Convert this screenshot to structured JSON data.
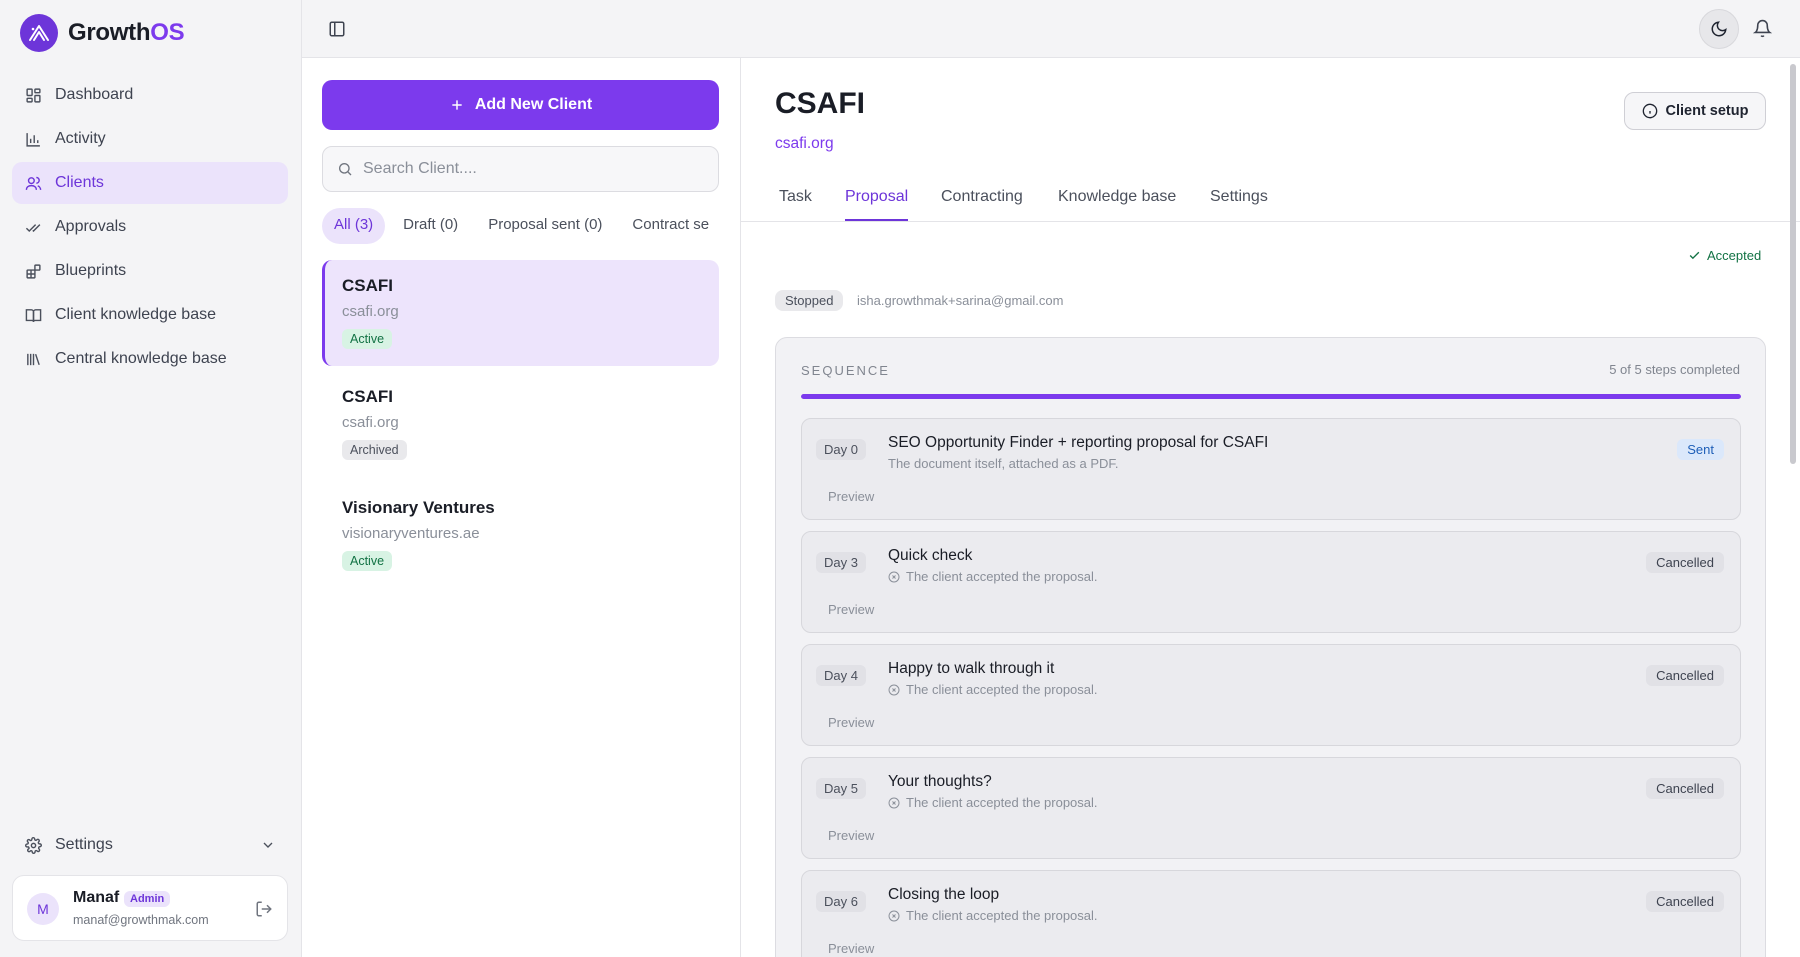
{
  "app": {
    "brand_main": "Growth",
    "brand_accent": "OS",
    "accent_color": "#7c3aed"
  },
  "sidebar": {
    "items": [
      {
        "label": "Dashboard",
        "icon": "dashboard-icon"
      },
      {
        "label": "Activity",
        "icon": "bar-chart-icon"
      },
      {
        "label": "Clients",
        "icon": "users-icon",
        "active": true
      },
      {
        "label": "Approvals",
        "icon": "check-check-icon"
      },
      {
        "label": "Blueprints",
        "icon": "blocks-icon"
      },
      {
        "label": "Client knowledge base",
        "icon": "book-open-icon"
      },
      {
        "label": "Central knowledge base",
        "icon": "library-icon"
      }
    ],
    "settings_label": "Settings",
    "user": {
      "initial": "M",
      "name": "Manaf",
      "role": "Admin",
      "email": "manaf@growthmak.com"
    }
  },
  "client_list": {
    "add_button": "Add New Client",
    "search_placeholder": "Search Client....",
    "filters": [
      "All (3)",
      "Draft (0)",
      "Proposal sent (0)",
      "Contract se"
    ],
    "clients": [
      {
        "name": "CSAFI",
        "domain": "csafi.org",
        "status": "Active"
      },
      {
        "name": "CSAFI",
        "domain": "csafi.org",
        "status": "Archived"
      },
      {
        "name": "Visionary Ventures",
        "domain": "visionaryventures.ae",
        "status": "Active"
      }
    ]
  },
  "detail": {
    "title": "CSAFI",
    "domain": "csafi.org",
    "setup_button": "Client setup",
    "tabs": [
      "Task",
      "Proposal",
      "Contracting",
      "Knowledge base",
      "Settings"
    ],
    "active_tab": "Proposal",
    "accepted_label": "Accepted",
    "run_status": "Stopped",
    "contact_email": "isha.growthmak+sarina@gmail.com",
    "sequence": {
      "label": "SEQUENCE",
      "progress_text": "5 of 5 steps completed",
      "progress_fraction": 1.0,
      "steps": [
        {
          "day": "Day 0",
          "title": "SEO Opportunity Finder + reporting proposal for CSAFI",
          "subtitle": "The document itself, attached as a PDF.",
          "preview": "Preview",
          "status": "Sent"
        },
        {
          "day": "Day 3",
          "title": "Quick check",
          "subtitle": "The client accepted the proposal.",
          "preview": "Preview",
          "status": "Cancelled"
        },
        {
          "day": "Day 4",
          "title": "Happy to walk through it",
          "subtitle": "The client accepted the proposal.",
          "preview": "Preview",
          "status": "Cancelled"
        },
        {
          "day": "Day 5",
          "title": "Your thoughts?",
          "subtitle": "The client accepted the proposal.",
          "preview": "Preview",
          "status": "Cancelled"
        },
        {
          "day": "Day 6",
          "title": "Closing the loop",
          "subtitle": "The client accepted the proposal.",
          "preview": "Preview",
          "status": "Cancelled"
        }
      ]
    }
  }
}
